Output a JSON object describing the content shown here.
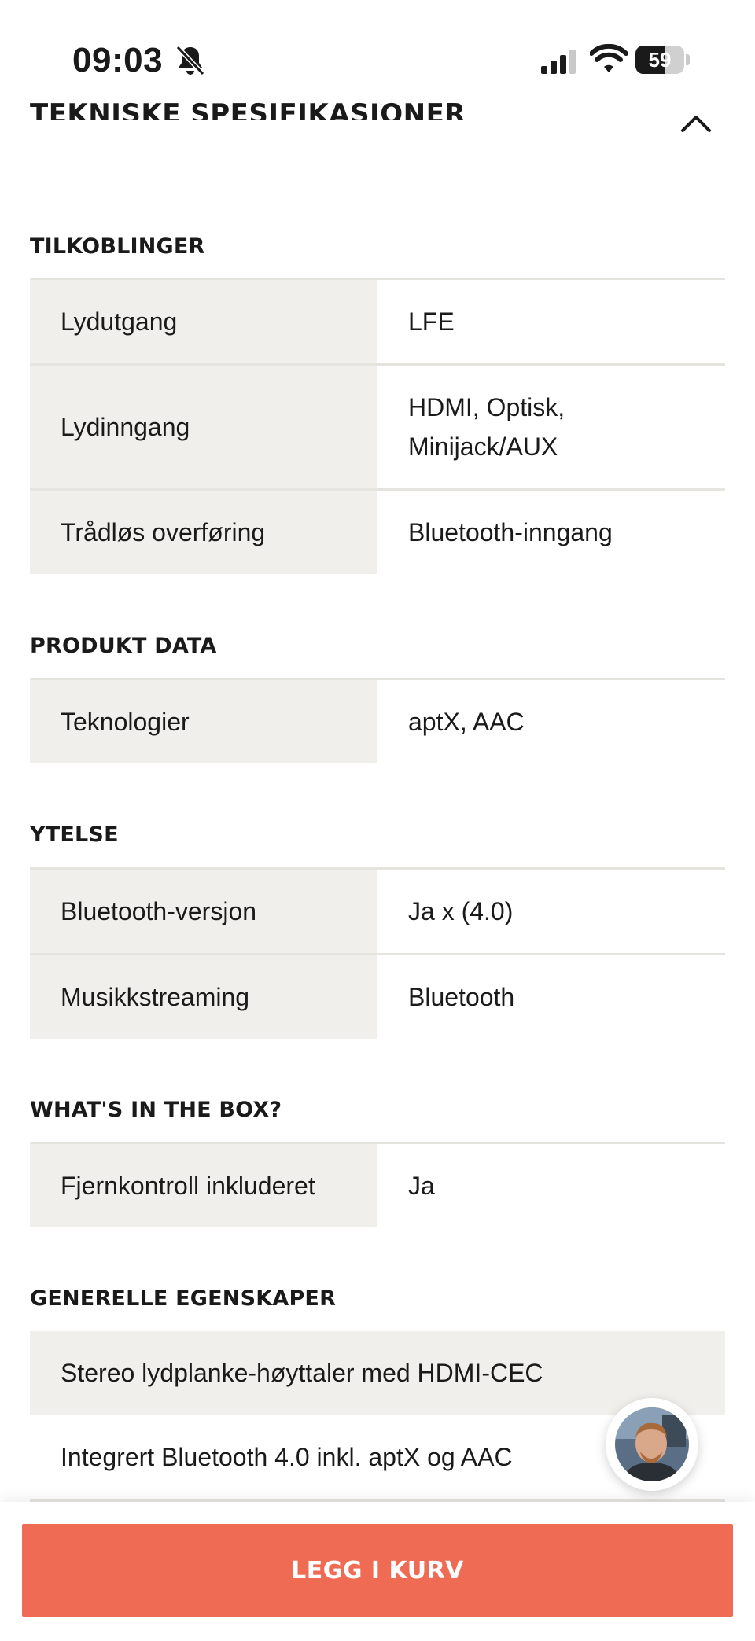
{
  "status_bar": {
    "time": "09:03",
    "battery": "59",
    "battery_level": 0.59,
    "icons": [
      "bell-muted-icon",
      "signal-icon",
      "wifi-icon",
      "battery-icon"
    ]
  },
  "section": {
    "title": "TEKNISKE SPESIFIKASJONER",
    "collapse_icon": "chevron-up-icon"
  },
  "groups": {
    "tilkoblinger": {
      "title": "TILKOBLINGER",
      "rows": [
        {
          "label": "Lydutgang",
          "value": "LFE"
        },
        {
          "label": "Lydinngang",
          "value_line1": "HDMI, Optisk,",
          "value_line2": "Minijack/AUX"
        },
        {
          "label": "Trådløs overføring",
          "value": "Bluetooth-inngang"
        }
      ]
    },
    "produkt_data": {
      "title": "PRODUKT DATA",
      "rows": [
        {
          "label": "Teknologier",
          "value": "aptX, AAC"
        }
      ]
    },
    "ytelse": {
      "title": "YTELSE",
      "rows": [
        {
          "label": "Bluetooth-versjon",
          "value": "Ja x (4.0)"
        },
        {
          "label": "Musikkstreaming",
          "value": "Bluetooth"
        }
      ]
    },
    "box": {
      "title": "WHAT'S IN THE BOX?",
      "rows": [
        {
          "label": "Fjernkontroll inkluderet",
          "value": "Ja"
        }
      ]
    },
    "generelle": {
      "title": "GENERELLE EGENSKAPER",
      "items": [
        "Stereo lydplanke-høyttaler med HDMI-CEC",
        "Integrert Bluetooth 4.0 inkl. aptX og AAC"
      ]
    }
  },
  "chat_avatar": "person-avatar-icon",
  "cart_button": "LEGG I KURV",
  "colors": {
    "accent": "#ef6b53",
    "label_bg": "#f1efeb",
    "divider": "#e6e4df"
  }
}
